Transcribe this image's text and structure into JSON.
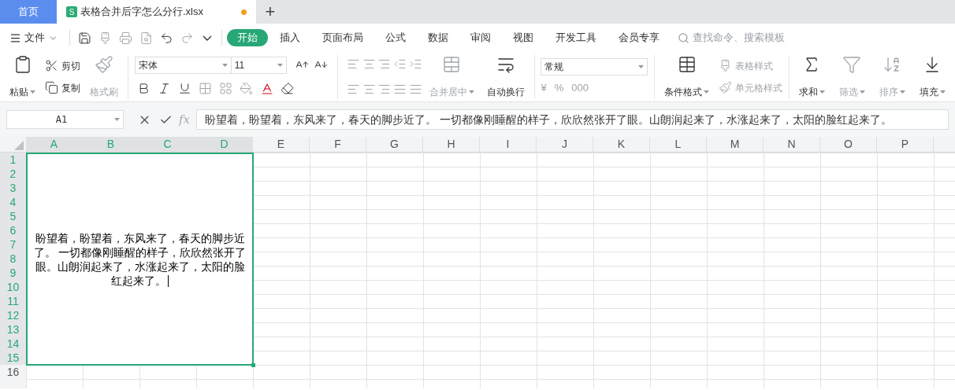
{
  "tab_bar": {
    "home_tab": {
      "label": "首页",
      "selected": false
    },
    "file_tab": {
      "app_icon": "S",
      "title": "表格合并后字怎么分行.xlsx",
      "selected": true,
      "unsaved": true
    },
    "new_tab": "+"
  },
  "menu_bar": {
    "file_menu": "文件",
    "tabs": [
      {
        "label": "开始",
        "selected": true
      },
      {
        "label": "插入",
        "selected": false
      },
      {
        "label": "页面布局",
        "selected": false
      },
      {
        "label": "公式",
        "selected": false
      },
      {
        "label": "数据",
        "selected": false
      },
      {
        "label": "审阅",
        "selected": false
      },
      {
        "label": "视图",
        "selected": false
      },
      {
        "label": "开发工具",
        "selected": false
      },
      {
        "label": "会员专享",
        "selected": false
      }
    ],
    "search": {
      "placeholder": "查找命令、搜索模板"
    }
  },
  "ribbon": {
    "paste": {
      "label": "粘贴",
      "disabled": false
    },
    "cut": {
      "label": "剪切",
      "disabled": false
    },
    "copy": {
      "label": "复制",
      "disabled": false
    },
    "format_painter": {
      "label": "格式刷",
      "disabled": true
    },
    "font_name": "宋体",
    "font_size": "11",
    "merge_center": {
      "label": "合并居中",
      "disabled": true
    },
    "wrap_text": {
      "label": "自动换行",
      "disabled": false
    },
    "number_format": "常规",
    "number_buttons": [
      "¥",
      "%",
      "000"
    ],
    "conditional_format": {
      "label": "条件格式",
      "disabled": false
    },
    "table_style": {
      "label": "表格样式",
      "disabled": true
    },
    "cell_style": {
      "label": "单元格样式",
      "disabled": true
    },
    "sum": {
      "label": "求和",
      "disabled": false
    },
    "filter": {
      "label": "筛选",
      "disabled": true
    },
    "sort": {
      "label": "排序",
      "disabled": true
    },
    "fill": {
      "label": "填充",
      "disabled": false
    }
  },
  "formula_bar": {
    "name_box": "A1",
    "function_label": "fx",
    "value": "盼望着，盼望着，东风来了，春天的脚步近了。  一切都像刚睡醒的样子，欣欣然张开了眼。山朗润起来了，水涨起来了，太阳的脸红起来了。"
  },
  "sheet": {
    "columns": [
      {
        "label": "A",
        "selected": true
      },
      {
        "label": "B",
        "selected": true
      },
      {
        "label": "C",
        "selected": true
      },
      {
        "label": "D",
        "selected": true
      },
      {
        "label": "E",
        "selected": false
      },
      {
        "label": "F",
        "selected": false
      },
      {
        "label": "G",
        "selected": false
      },
      {
        "label": "H",
        "selected": false
      },
      {
        "label": "I",
        "selected": false
      },
      {
        "label": "J",
        "selected": false
      },
      {
        "label": "K",
        "selected": false
      },
      {
        "label": "L",
        "selected": false
      },
      {
        "label": "M",
        "selected": false
      },
      {
        "label": "N",
        "selected": false
      },
      {
        "label": "O",
        "selected": false
      },
      {
        "label": "P",
        "selected": false
      }
    ],
    "rows": [
      {
        "label": "1",
        "selected": true
      },
      {
        "label": "2",
        "selected": true
      },
      {
        "label": "3",
        "selected": true
      },
      {
        "label": "4",
        "selected": true
      },
      {
        "label": "5",
        "selected": true
      },
      {
        "label": "6",
        "selected": true
      },
      {
        "label": "7",
        "selected": true
      },
      {
        "label": "8",
        "selected": true
      },
      {
        "label": "9",
        "selected": true
      },
      {
        "label": "10",
        "selected": true
      },
      {
        "label": "11",
        "selected": true
      },
      {
        "label": "12",
        "selected": true
      },
      {
        "label": "13",
        "selected": true
      },
      {
        "label": "14",
        "selected": true
      },
      {
        "label": "15",
        "selected": true
      },
      {
        "label": "16",
        "selected": false
      }
    ],
    "merged_cell": {
      "text": "盼望着，盼望着，东风来了，春天的脚步近了。  一切都像刚睡醒的样子，欣欣然张开了眼。山朗润起来了，水涨起来了，太阳的脸红起来了。",
      "editing": true
    }
  }
}
